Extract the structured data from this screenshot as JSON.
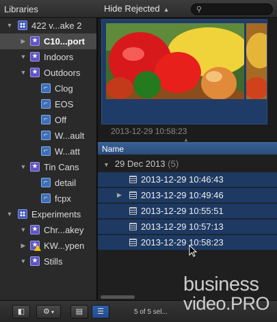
{
  "header": {
    "libraries_title": "Libraries",
    "filter_label": "Hide Rejected",
    "search_placeholder": ""
  },
  "sidebar": {
    "items": [
      {
        "label": "422 v...ake 2",
        "type": "library",
        "expanded": true
      },
      {
        "label": "C10...port",
        "type": "event",
        "selected": true,
        "expanded": false
      },
      {
        "label": "Indoors",
        "type": "event",
        "expanded": true
      },
      {
        "label": "Outdoors",
        "type": "event",
        "expanded": true
      },
      {
        "label": "Clog",
        "type": "keyword"
      },
      {
        "label": "EOS",
        "type": "keyword"
      },
      {
        "label": "Off",
        "type": "keyword"
      },
      {
        "label": "W...ault",
        "type": "keyword"
      },
      {
        "label": "W...att",
        "type": "keyword"
      },
      {
        "label": "Tin Cans",
        "type": "event",
        "expanded": true
      },
      {
        "label": "detail",
        "type": "keyword"
      },
      {
        "label": "fcpx",
        "type": "keyword"
      },
      {
        "label": "Experiments",
        "type": "library",
        "expanded": true
      },
      {
        "label": "Chr...akey",
        "type": "event",
        "expanded": true
      },
      {
        "label": "KW...ypen",
        "type": "event",
        "warning": true,
        "expanded": false
      },
      {
        "label": "Stills",
        "type": "event",
        "expanded": true
      }
    ]
  },
  "preview": {
    "timestamp": "2013-12-29 10:58:23"
  },
  "list": {
    "column_name": "Name",
    "group": {
      "label": "29 Dec 2013",
      "count": "(5)"
    },
    "clips": [
      {
        "label": "2013-12-29 10:46:43",
        "has_disclosure": false
      },
      {
        "label": "2013-12-29 10:49:46",
        "has_disclosure": true
      },
      {
        "label": "2013-12-29 10:55:51",
        "has_disclosure": false
      },
      {
        "label": "2013-12-29 10:57:13",
        "has_disclosure": false
      },
      {
        "label": "2013-12-29 10:58:23",
        "has_disclosure": false
      }
    ]
  },
  "footer": {
    "selection_count": "5 of 5 sel..."
  },
  "watermark": {
    "line1": "business",
    "line2": "video.PRO"
  },
  "colors": {
    "selection_blue": "#1e3a63",
    "header_blue": "#2b4d7c",
    "event_icon": "#5d54c4",
    "library_icon": "#3f56b6"
  }
}
